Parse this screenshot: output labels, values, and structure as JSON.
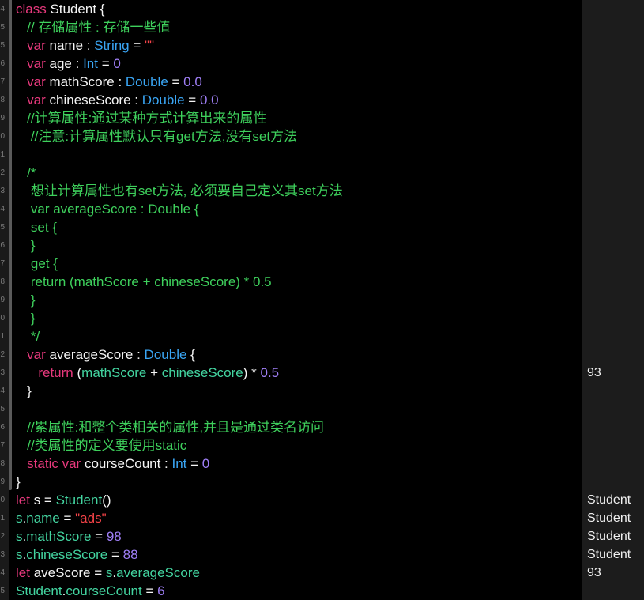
{
  "editor": {
    "colors": {
      "keyword": "#e8397d",
      "type": "#3aa6f5",
      "number": "#9f7ff6",
      "string": "#f64348",
      "comment": "#3ed05c",
      "plain": "#f5f5f5",
      "identifier": "#43d4a0",
      "background": "#000000",
      "results_background": "#1c1c1c"
    },
    "gutter_digits": [
      "4",
      "5",
      "5",
      "6",
      "7",
      "8",
      "9",
      "0",
      "1",
      "2",
      "3",
      "4",
      "5",
      "6",
      "7",
      "8",
      "9",
      "0",
      "1",
      "2",
      "3",
      "4",
      "5",
      "6",
      "7",
      "8",
      "9",
      "0",
      "1",
      "2",
      "3",
      "4",
      "5"
    ],
    "lines": [
      [
        {
          "t": "class",
          "c": "kw"
        },
        {
          "t": " Student {",
          "c": "pl"
        }
      ],
      [
        {
          "t": "   // 存储属性 : 存储一些值",
          "c": "cm"
        }
      ],
      [
        {
          "t": "   ",
          "c": "pl"
        },
        {
          "t": "var",
          "c": "kw"
        },
        {
          "t": " name : ",
          "c": "pl"
        },
        {
          "t": "String",
          "c": "ty"
        },
        {
          "t": " = ",
          "c": "pl"
        },
        {
          "t": "\"\"",
          "c": "st"
        }
      ],
      [
        {
          "t": "   ",
          "c": "pl"
        },
        {
          "t": "var",
          "c": "kw"
        },
        {
          "t": " age : ",
          "c": "pl"
        },
        {
          "t": "Int",
          "c": "ty"
        },
        {
          "t": " = ",
          "c": "pl"
        },
        {
          "t": "0",
          "c": "nu"
        }
      ],
      [
        {
          "t": "   ",
          "c": "pl"
        },
        {
          "t": "var",
          "c": "kw"
        },
        {
          "t": " mathScore : ",
          "c": "pl"
        },
        {
          "t": "Double",
          "c": "ty"
        },
        {
          "t": " = ",
          "c": "pl"
        },
        {
          "t": "0.0",
          "c": "nu"
        }
      ],
      [
        {
          "t": "   ",
          "c": "pl"
        },
        {
          "t": "var",
          "c": "kw"
        },
        {
          "t": " chineseScore : ",
          "c": "pl"
        },
        {
          "t": "Double",
          "c": "ty"
        },
        {
          "t": " = ",
          "c": "pl"
        },
        {
          "t": "0.0",
          "c": "nu"
        }
      ],
      [
        {
          "t": "   //计算属性:通过某种方式计算出来的属性",
          "c": "cm"
        }
      ],
      [
        {
          "t": "    //注意:计算属性默认只有get方法,没有set方法",
          "c": "cm"
        }
      ],
      [],
      [
        {
          "t": "   /*",
          "c": "cm"
        }
      ],
      [
        {
          "t": "    想让计算属性也有set方法, 必须要自己定义其set方法",
          "c": "cm"
        }
      ],
      [
        {
          "t": "    var averageScore : Double {",
          "c": "cm"
        }
      ],
      [
        {
          "t": "    set {",
          "c": "cm"
        }
      ],
      [
        {
          "t": "    }",
          "c": "cm"
        }
      ],
      [
        {
          "t": "    get {",
          "c": "cm"
        }
      ],
      [
        {
          "t": "    return (mathScore + chineseScore) * 0.5",
          "c": "cm"
        }
      ],
      [
        {
          "t": "    }",
          "c": "cm"
        }
      ],
      [
        {
          "t": "    }",
          "c": "cm"
        }
      ],
      [
        {
          "t": "    */",
          "c": "cm"
        }
      ],
      [
        {
          "t": "   ",
          "c": "pl"
        },
        {
          "t": "var",
          "c": "kw"
        },
        {
          "t": " averageScore : ",
          "c": "pl"
        },
        {
          "t": "Double",
          "c": "ty"
        },
        {
          "t": " {",
          "c": "pl"
        }
      ],
      [
        {
          "t": "      ",
          "c": "pl"
        },
        {
          "t": "return",
          "c": "kw"
        },
        {
          "t": " (",
          "c": "pl"
        },
        {
          "t": "mathScore",
          "c": "id"
        },
        {
          "t": " + ",
          "c": "pl"
        },
        {
          "t": "chineseScore",
          "c": "id"
        },
        {
          "t": ") * ",
          "c": "pl"
        },
        {
          "t": "0.5",
          "c": "nu"
        }
      ],
      [
        {
          "t": "   }",
          "c": "pl"
        }
      ],
      [],
      [
        {
          "t": "   //累属性:和整个类相关的属性,并且是通过类名访问",
          "c": "cm"
        }
      ],
      [
        {
          "t": "   //类属性的定义要使用static",
          "c": "cm"
        }
      ],
      [
        {
          "t": "   ",
          "c": "pl"
        },
        {
          "t": "static",
          "c": "kw"
        },
        {
          "t": " ",
          "c": "pl"
        },
        {
          "t": "var",
          "c": "kw"
        },
        {
          "t": " courseCount : ",
          "c": "pl"
        },
        {
          "t": "Int",
          "c": "ty"
        },
        {
          "t": " = ",
          "c": "pl"
        },
        {
          "t": "0",
          "c": "nu"
        }
      ],
      [
        {
          "t": "}",
          "c": "pl"
        }
      ],
      [
        {
          "t": "let",
          "c": "kw"
        },
        {
          "t": " s = ",
          "c": "pl"
        },
        {
          "t": "Student",
          "c": "id"
        },
        {
          "t": "()",
          "c": "pl"
        }
      ],
      [
        {
          "t": "s",
          "c": "id"
        },
        {
          "t": ".",
          "c": "pl"
        },
        {
          "t": "name",
          "c": "id"
        },
        {
          "t": " = ",
          "c": "pl"
        },
        {
          "t": "\"ads\"",
          "c": "st"
        }
      ],
      [
        {
          "t": "s",
          "c": "id"
        },
        {
          "t": ".",
          "c": "pl"
        },
        {
          "t": "mathScore",
          "c": "id"
        },
        {
          "t": " = ",
          "c": "pl"
        },
        {
          "t": "98",
          "c": "nu"
        }
      ],
      [
        {
          "t": "s",
          "c": "id"
        },
        {
          "t": ".",
          "c": "pl"
        },
        {
          "t": "chineseScore",
          "c": "id"
        },
        {
          "t": " = ",
          "c": "pl"
        },
        {
          "t": "88",
          "c": "nu"
        }
      ],
      [
        {
          "t": "let",
          "c": "kw"
        },
        {
          "t": " aveScore = ",
          "c": "pl"
        },
        {
          "t": "s",
          "c": "id"
        },
        {
          "t": ".",
          "c": "pl"
        },
        {
          "t": "averageScore",
          "c": "id"
        }
      ],
      [
        {
          "t": "Student",
          "c": "id"
        },
        {
          "t": ".",
          "c": "pl"
        },
        {
          "t": "courseCount",
          "c": "id"
        },
        {
          "t": " = ",
          "c": "pl"
        },
        {
          "t": "6",
          "c": "nu"
        }
      ]
    ]
  },
  "results": {
    "items": [
      {
        "line": 20,
        "text": "93"
      },
      {
        "line": 27,
        "text": "Student"
      },
      {
        "line": 28,
        "text": "Student"
      },
      {
        "line": 29,
        "text": "Student"
      },
      {
        "line": 30,
        "text": "Student"
      },
      {
        "line": 31,
        "text": "93"
      }
    ]
  }
}
